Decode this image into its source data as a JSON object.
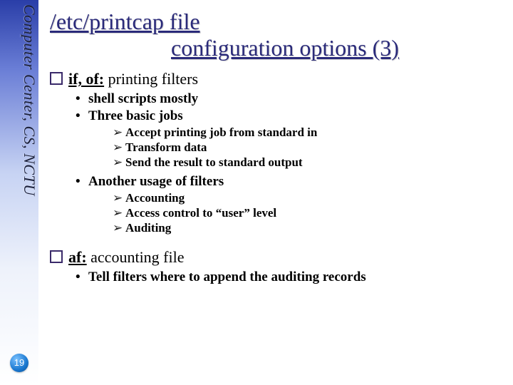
{
  "sidebar": {
    "label": "Computer Center, CS, NCTU",
    "page": "19"
  },
  "title": {
    "line1": "/etc/printcap file",
    "line2": "configuration options (3)"
  },
  "sec1": {
    "key": "if, of:",
    "rest": " printing filters",
    "b1": "shell scripts mostly",
    "b2": "Three basic jobs",
    "a1": "Accept printing job from standard in",
    "a2": "Transform data",
    "a3": "Send the result to standard output",
    "b3": "Another usage of filters",
    "a4": "Accounting",
    "a5": "Access control to “user” level",
    "a6": "Auditing"
  },
  "sec2": {
    "key": "af:",
    "rest": " accounting file",
    "b1": "Tell filters where to append the auditing records"
  }
}
